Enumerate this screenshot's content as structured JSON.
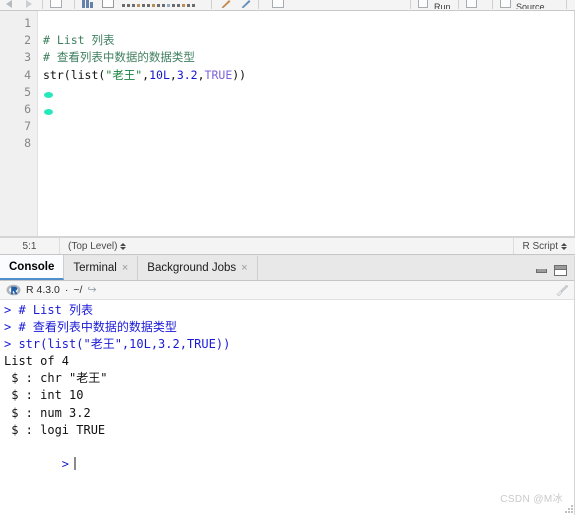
{
  "toolbar": {
    "run_label": "Run",
    "source_label": "Source",
    "icons": [
      "back-arrow-icon",
      "forward-arrow-icon",
      "save-icon",
      "compile-report-icon",
      "document-icon",
      "find-replace-icon",
      "magic-wand-icon",
      "pencil-icon",
      "rerun-icon"
    ]
  },
  "editor": {
    "line_numbers": [
      "1",
      "2",
      "3",
      "4",
      "5",
      "6",
      "7",
      "8"
    ],
    "lines": [
      {
        "n": "1",
        "tokens": []
      },
      {
        "n": "2",
        "tokens": [
          {
            "t": "# List 列表",
            "c": "tok-comment"
          }
        ]
      },
      {
        "n": "3",
        "tokens": [
          {
            "t": "# 查看列表中数据的数据类型",
            "c": "tok-comment"
          }
        ]
      },
      {
        "n": "4",
        "tokens": [
          {
            "t": "str(list(",
            "c": "tok-plain"
          },
          {
            "t": "\"老王\"",
            "c": "tok-str"
          },
          {
            "t": ",",
            "c": "tok-plain"
          },
          {
            "t": "10L",
            "c": "tok-num"
          },
          {
            "t": ",",
            "c": "tok-plain"
          },
          {
            "t": "3.2",
            "c": "tok-num"
          },
          {
            "t": ",",
            "c": "tok-plain"
          },
          {
            "t": "TRUE",
            "c": "tok-bool"
          },
          {
            "t": "))",
            "c": "tok-plain"
          }
        ]
      },
      {
        "n": "5",
        "tokens": []
      },
      {
        "n": "6",
        "tokens": []
      },
      {
        "n": "7",
        "tokens": []
      },
      {
        "n": "8",
        "tokens": []
      }
    ]
  },
  "editor_status": {
    "cursor_position": "5:1",
    "scope": "(Top Level)",
    "file_type": "R Script"
  },
  "console_panel": {
    "tabs": [
      {
        "label": "Console",
        "active": true,
        "closable": false
      },
      {
        "label": "Terminal",
        "active": false,
        "closable": true
      },
      {
        "label": "Background Jobs",
        "active": false,
        "closable": true
      }
    ],
    "close_glyph": "×",
    "header": {
      "logo": "r-logo-icon",
      "version": "R 4.3.0",
      "separator": "·",
      "working_dir": "~/",
      "share_glyph": "↪",
      "clear_icon": "broom-icon"
    },
    "output_lines": [
      {
        "text": "> # List 列表",
        "c": "c-in"
      },
      {
        "text": "> # 查看列表中数据的数据类型",
        "c": "c-in"
      },
      {
        "text": "> str(list(\"老王\",10L,3.2,TRUE))",
        "c": "c-in"
      },
      {
        "text": "List of 4",
        "c": "c-out"
      },
      {
        "text": " $ : chr \"老王\"",
        "c": "c-out"
      },
      {
        "text": " $ : int 10",
        "c": "c-out"
      },
      {
        "text": " $ : num 3.2",
        "c": "c-out"
      },
      {
        "text": " $ : logi TRUE",
        "c": "c-out"
      }
    ],
    "prompt": ">"
  },
  "watermark": "CSDN @M冰",
  "colors": {
    "comment": "#3f7f5f",
    "string": "#17843f",
    "number": "#1515cd",
    "boolean": "#7d62d6",
    "console_input": "#1a1ad6",
    "active_tab_underline": "#4d8ecb",
    "editor_marker": "#25e8bb"
  }
}
